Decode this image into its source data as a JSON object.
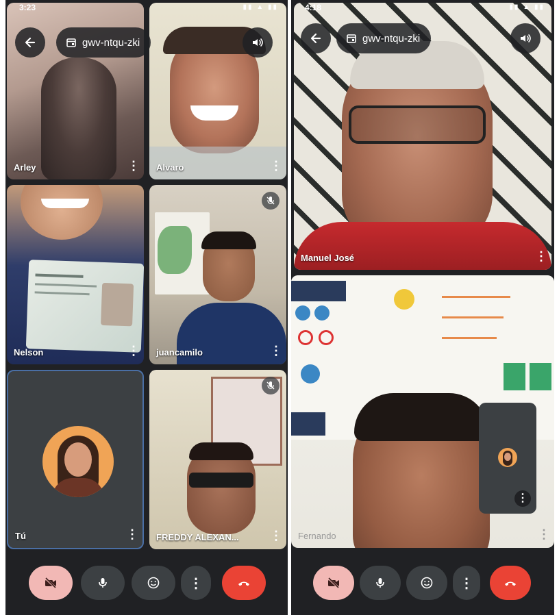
{
  "left_phone": {
    "status_time": "3:23",
    "meeting_code": "gwv-ntqu-zki",
    "participants": [
      {
        "name": "Arley"
      },
      {
        "name": "Alvaro"
      },
      {
        "name": "Nelson"
      },
      {
        "name": "juancamilo"
      },
      {
        "name": "Tú"
      },
      {
        "name": "FREDDY ALEXAN..."
      }
    ]
  },
  "right_phone": {
    "status_time": "4:18",
    "meeting_code": "gwv-ntqu-zki",
    "participants": [
      {
        "name": "Manuel José"
      },
      {
        "name": "Fernando"
      }
    ]
  },
  "icons": {
    "back": "arrow-left-icon",
    "calendar": "calendar-icon",
    "speaker": "speaker-icon",
    "more": "more-vertical-icon",
    "mic_off": "mic-off-icon",
    "camera_off": "camera-off-icon",
    "mic": "mic-icon",
    "emoji": "emoji-icon",
    "hangup": "hangup-icon"
  },
  "colors": {
    "background": "#202124",
    "camera_off_button": "#f2b8b5",
    "hangup": "#ea4335",
    "control": "#3c4043",
    "self_tile": "#3c4043"
  }
}
